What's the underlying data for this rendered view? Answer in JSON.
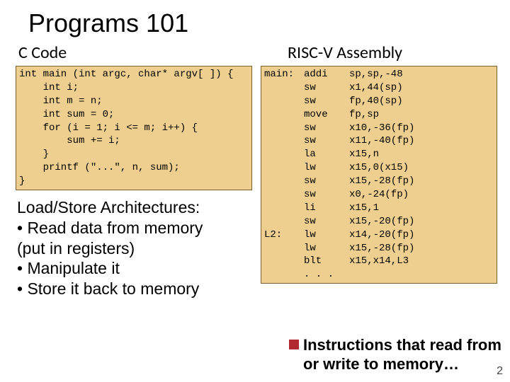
{
  "title": "Programs 101",
  "left": {
    "heading": "C Code",
    "code": "int main (int argc, char* argv[ ]) {\n    int i;\n    int m = n;\n    int sum = 0;\n    for (i = 1; i <= m; i++) {\n        sum += i;\n    }\n    printf (\"...\", n, sum);\n}"
  },
  "right": {
    "heading": "RISC-V Assembly",
    "labels": "main:\n\n\n\n\n\n\n\n\n\n\n\nL2:\n\n\n",
    "ops": "addi\nsw\nsw\nmove\nsw\nsw\nla\nlw\nsw\nsw\nli\nsw\nlw\nlw\nblt\n. . .",
    "args": "sp,sp,-48\nx1,44(sp)\nfp,40(sp)\nfp,sp\nx10,-36(fp)\nx11,-40(fp)\nx15,n\nx15,0(x15)\nx15,-28(fp)\nx0,-24(fp)\nx15,1\nx15,-20(fp)\nx14,-20(fp)\nx15,-28(fp)\nx15,x14,L3\n"
  },
  "explain": {
    "head": "Load/Store Architectures:",
    "b1": "• Read data from memory",
    "b1b": "   (put in registers)",
    "b2": "• Manipulate it",
    "b3": "• Store it back to memory"
  },
  "callout": {
    "line1": "Instructions that read from",
    "line2": "or write to memory…"
  },
  "page": "2"
}
